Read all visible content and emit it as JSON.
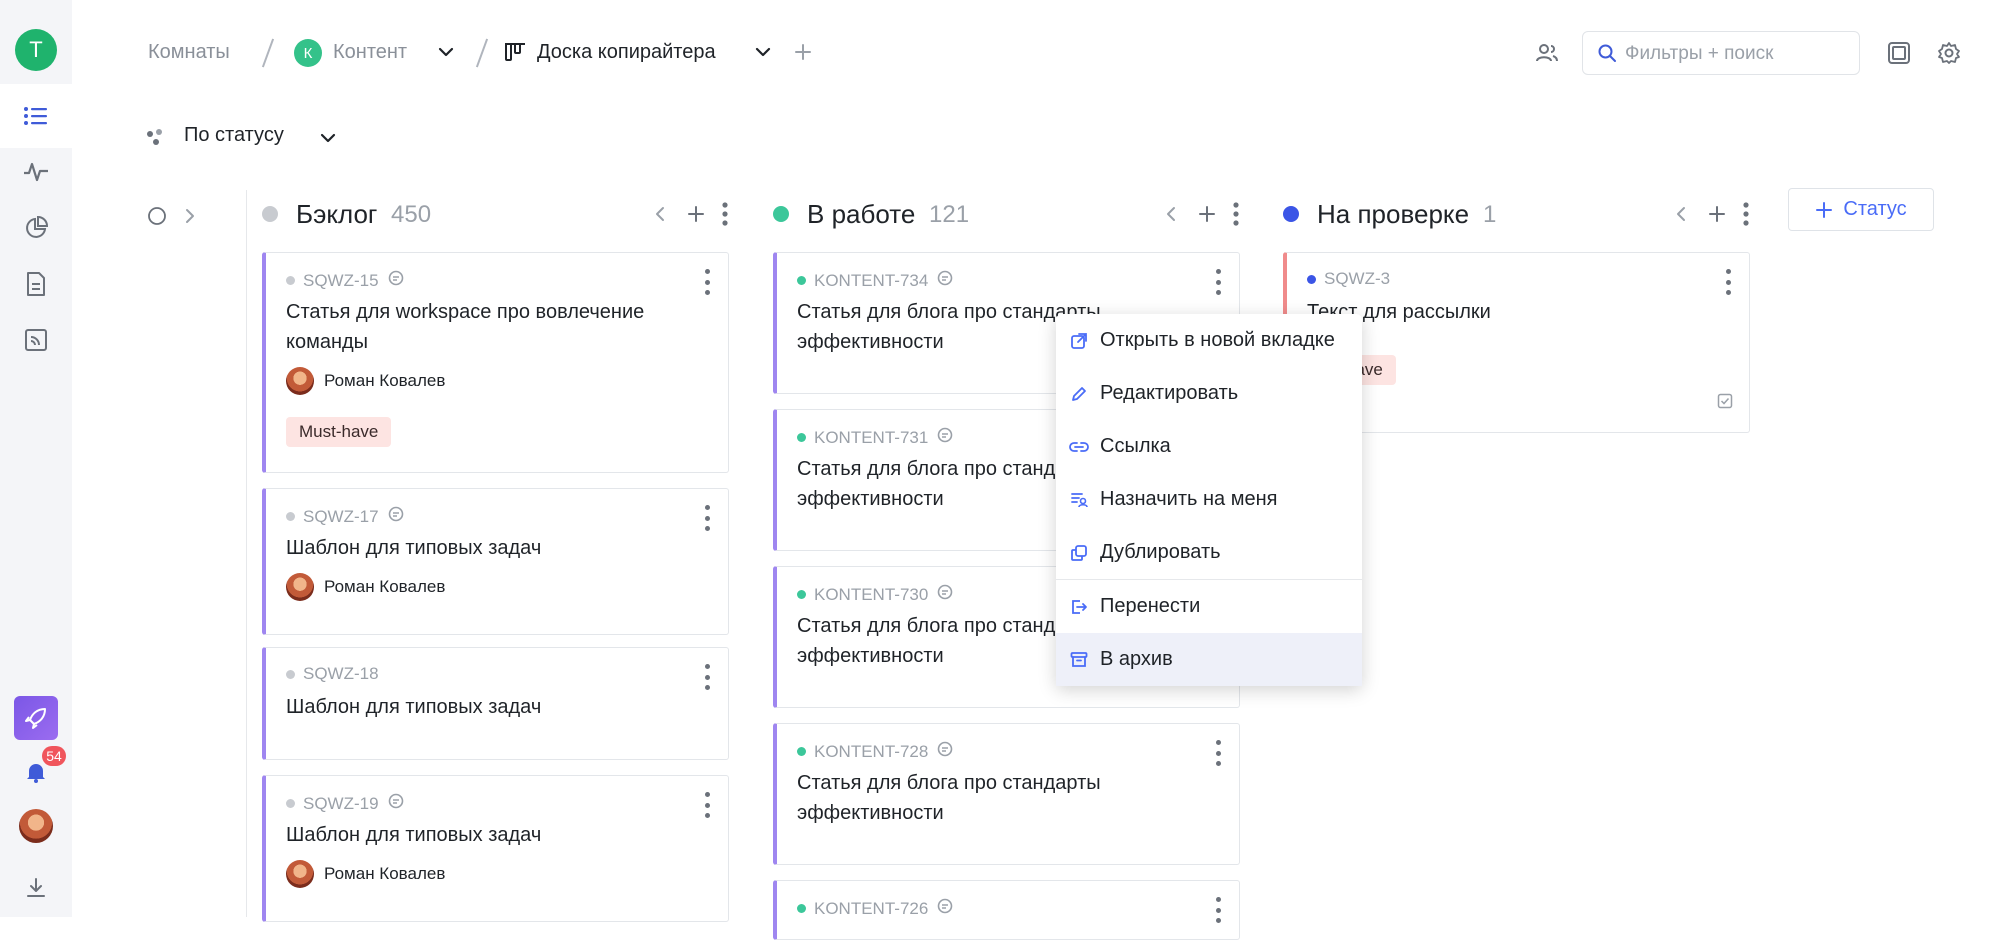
{
  "workspace": {
    "initial": "Т"
  },
  "breadcrumbs": {
    "rooms": "Комнаты",
    "space_initial": "К",
    "space": "Контент",
    "board": "Доска копирайтера"
  },
  "search": {
    "placeholder": "Фильтры + поиск"
  },
  "grouping": {
    "label": "По статусу"
  },
  "notifications": {
    "count": "54"
  },
  "add_status_label": "Статус",
  "columns": [
    {
      "title": "Бэклог",
      "count": "450",
      "color": "#c8cbd0"
    },
    {
      "title": "В работе",
      "count": "121",
      "color": "#3cc79a"
    },
    {
      "title": "На проверке",
      "count": "1",
      "color": "#3b55e6"
    }
  ],
  "backlog_cards": [
    {
      "id": "SQWZ-15",
      "title": "Статья для workspace про вовлечение команды",
      "assignee": "Роман Ковалев",
      "tag": "Must-have"
    },
    {
      "id": "SQWZ-17",
      "title": "Шаблон для типовых задач",
      "assignee": "Роман Ковалев"
    },
    {
      "id": "SQWZ-18",
      "title": "Шаблон для типовых задач"
    },
    {
      "id": "SQWZ-19",
      "title": "Шаблон для типовых задач",
      "assignee": "Роман Ковалев"
    }
  ],
  "work_cards": [
    {
      "id": "KONTENT-734",
      "title": "Статья для блога про стандарты эффективности"
    },
    {
      "id": "KONTENT-731",
      "title": "Статья для блога про станд",
      "title2": "эффективности"
    },
    {
      "id": "KONTENT-730",
      "title": "Статья для блога про станд",
      "title2": "эффективности"
    },
    {
      "id": "KONTENT-728",
      "title": "Статья для блога про стандарты эффективности"
    },
    {
      "id": "KONTENT-726"
    }
  ],
  "review_cards": [
    {
      "id": "SQWZ-3",
      "title": "Текст для рассылки",
      "tag": "have"
    }
  ],
  "context_menu": {
    "items": [
      "Открыть в новой вкладке",
      "Редактировать",
      "Ссылка",
      "Назначить на меня",
      "Дублировать",
      "Перенести",
      "В архив"
    ],
    "selected": "В архив",
    "accent": "#4a6cf7"
  }
}
